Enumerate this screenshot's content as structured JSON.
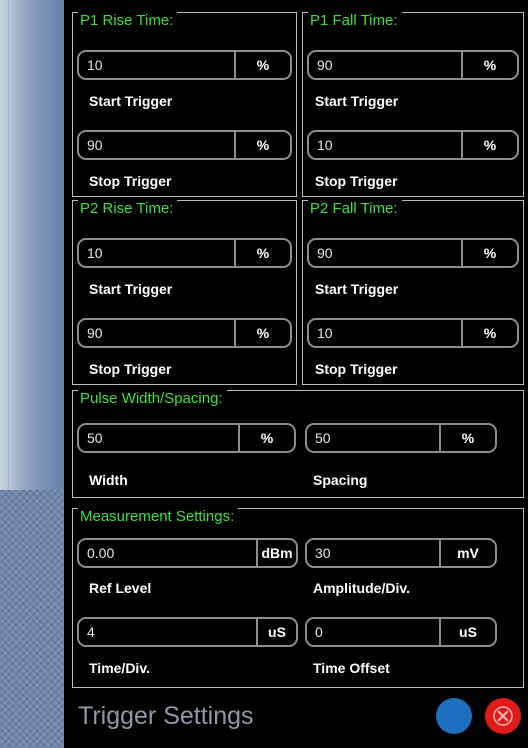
{
  "groups": {
    "p1_rise": {
      "title": "P1 Rise Time:",
      "start": {
        "value": "10",
        "unit": "%",
        "label": "Start Trigger"
      },
      "stop": {
        "value": "90",
        "unit": "%",
        "label": "Stop Trigger"
      }
    },
    "p1_fall": {
      "title": "P1 Fall Time:",
      "start": {
        "value": "90",
        "unit": "%",
        "label": "Start Trigger"
      },
      "stop": {
        "value": "10",
        "unit": "%",
        "label": "Stop Trigger"
      }
    },
    "p2_rise": {
      "title": "P2 Rise Time:",
      "start": {
        "value": "10",
        "unit": "%",
        "label": "Start Trigger"
      },
      "stop": {
        "value": "90",
        "unit": "%",
        "label": "Stop Trigger"
      }
    },
    "p2_fall": {
      "title": "P2 Fall Time:",
      "start": {
        "value": "90",
        "unit": "%",
        "label": "Start Trigger"
      },
      "stop": {
        "value": "10",
        "unit": "%",
        "label": "Stop Trigger"
      }
    },
    "pulse": {
      "title": "Pulse Width/Spacing:",
      "width": {
        "value": "50",
        "unit": "%",
        "label": "Width"
      },
      "spacing": {
        "value": "50",
        "unit": "%",
        "label": "Spacing"
      }
    },
    "measurement": {
      "title": "Measurement Settings:",
      "ref_level": {
        "value": "0.00",
        "unit": "dBm",
        "label": "Ref Level"
      },
      "amplitude": {
        "value": "30",
        "unit": "mV",
        "label": "Amplitude/Div."
      },
      "time_div": {
        "value": "4",
        "unit": "uS",
        "label": "Time/Div."
      },
      "time_offset": {
        "value": "0",
        "unit": "uS",
        "label": "Time Offset"
      }
    }
  },
  "footer": {
    "title": "Trigger Settings",
    "blue_button_icon": "circle-icon",
    "close_button_icon": "close-icon"
  },
  "colors": {
    "group_title": "#3ce03c",
    "background": "#000000",
    "blue_button": "#1f6fc0",
    "close_button": "#e01b1b"
  }
}
